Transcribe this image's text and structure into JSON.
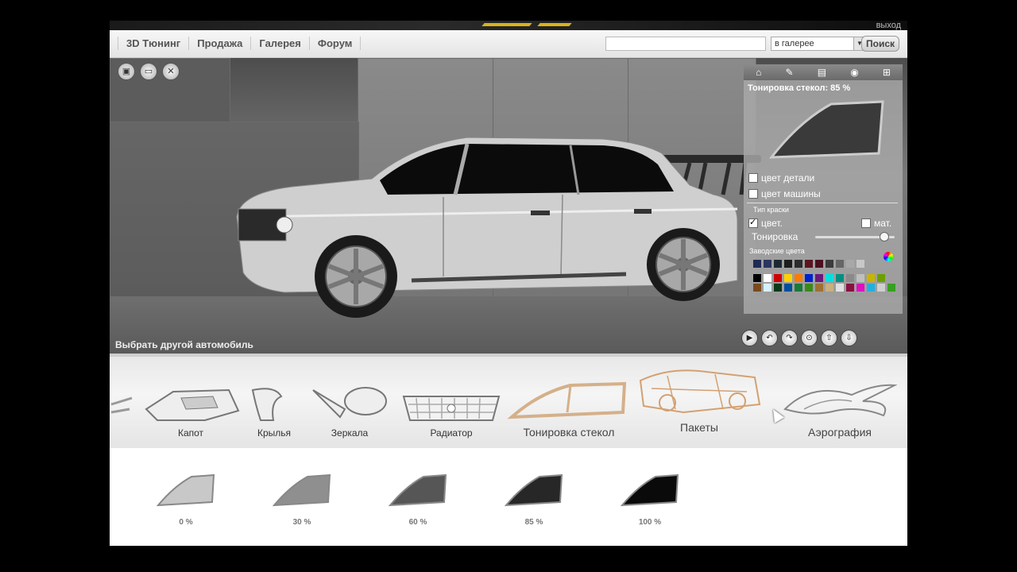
{
  "topbar": {
    "exit_label": "выход"
  },
  "nav": {
    "items": [
      "3D Тюнинг",
      "Продажа",
      "Галерея",
      "Форум"
    ]
  },
  "search": {
    "value": "",
    "scope": "в галерее",
    "button": "Поиск"
  },
  "viewer": {
    "choose_car": "Выбрать другой автомобиль"
  },
  "panel": {
    "title": "Тонировка стекол: 85 %",
    "part_color": "цвет детали",
    "car_color": "цвет машины",
    "paint_type": "Тип краски",
    "gloss": "цвет.",
    "matte": "мат.",
    "tint_label": "Тонировка",
    "tint_level": 0.85,
    "factory_colors": "Заводские цвета",
    "factory_swatches": [
      "#1f2a55",
      "#2a3560",
      "#1c2933",
      "#1d1d1d",
      "#2c2c2c",
      "#5a1520",
      "#4a1020",
      "#3b3b3b",
      "#666666",
      "#a8a8a8",
      "#c8c8c8"
    ],
    "swatch_row1": [
      "#000000",
      "#ffffff",
      "#d00000",
      "#ffd200",
      "#ff7a00",
      "#0022cc",
      "#6a1a7a",
      "#00e0e0",
      "#009080",
      "#8a8a8a",
      "#bfbfbf",
      "#c8b400",
      "#6aa000"
    ],
    "swatch_row2": [
      "#7a4a1a",
      "#d8f0ff",
      "#0a3a1a",
      "#00509a",
      "#1a7a3a",
      "#3a8a1a",
      "#a07030",
      "#c8b080",
      "#e0e0e0",
      "#8a1040",
      "#e010c0",
      "#20b0e0",
      "#cfcfcf",
      "#38a020"
    ]
  },
  "parts": {
    "items": [
      "Капот",
      "Крылья",
      "Зеркала",
      "Радиатор",
      "Тонировка стекол",
      "Пакеты",
      "Аэрография"
    ]
  },
  "tints": {
    "items": [
      "0 %",
      "30 %",
      "60 %",
      "85 %",
      "100 %"
    ],
    "levels": [
      0,
      0.3,
      0.6,
      0.85,
      1.0
    ]
  }
}
